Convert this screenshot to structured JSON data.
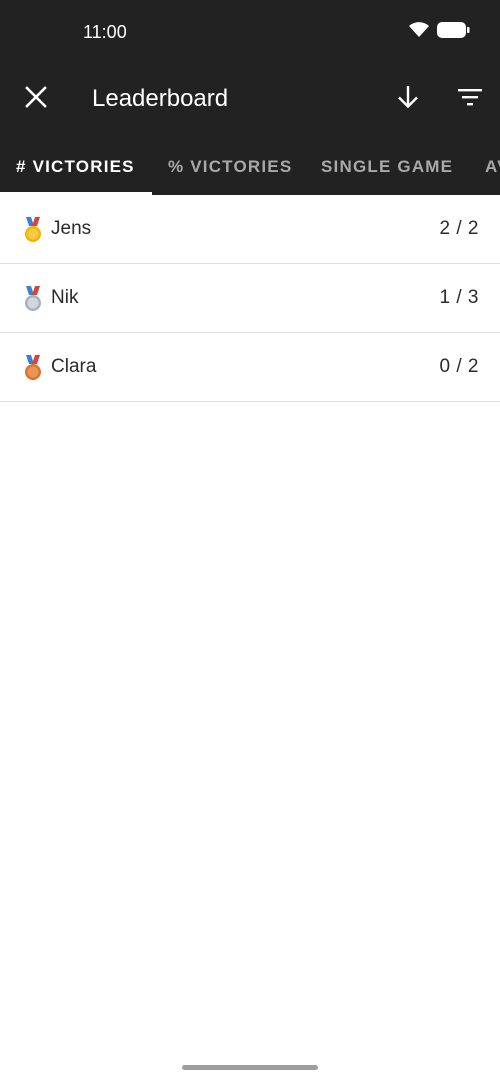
{
  "status_bar": {
    "time": "11:00",
    "icons": [
      "wifi-icon",
      "battery-icon"
    ]
  },
  "toolbar": {
    "close_icon": "close-icon",
    "title": "Leaderboard",
    "sort_icon": "arrow-down-icon",
    "filter_icon": "filter-icon"
  },
  "tabs": [
    {
      "label": "# VICTORIES",
      "active": true
    },
    {
      "label": "% VICTORIES",
      "active": false
    },
    {
      "label": "SINGLE GAME",
      "active": false
    },
    {
      "label": "AVERAGE",
      "active": false
    }
  ],
  "leaderboard": [
    {
      "medal": "gold-medal-icon",
      "name": "Jens",
      "score": "2 / 2"
    },
    {
      "medal": "silver-medal-icon",
      "name": "Nik",
      "score": "1 / 3"
    },
    {
      "medal": "bronze-medal-icon",
      "name": "Clara",
      "score": "0 / 2"
    }
  ],
  "colors": {
    "header_bg": "#222222",
    "gold": "#f4b400",
    "silver": "#b9c0c7",
    "bronze": "#d9752b"
  }
}
